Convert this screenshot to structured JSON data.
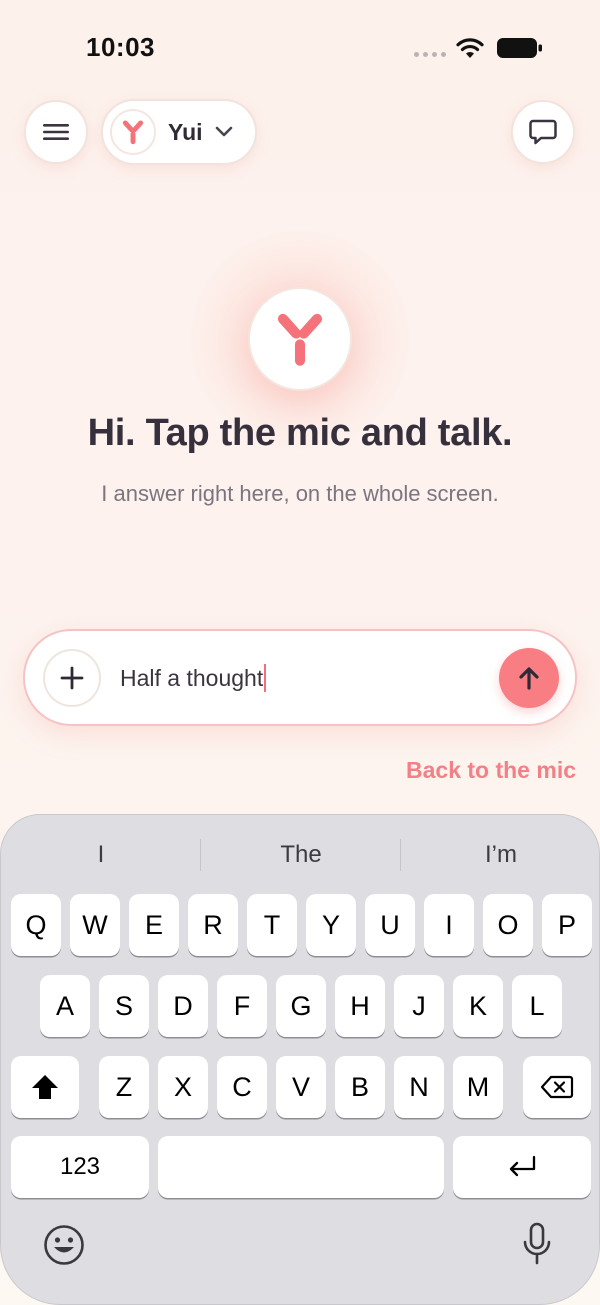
{
  "status_bar": {
    "time": "10:03"
  },
  "header": {
    "persona_name": "Yui"
  },
  "hero": {
    "title": "Hi. Tap the mic and talk.",
    "subtitle": "I answer right here, on the whole screen."
  },
  "composer": {
    "input_value": "Half a thought"
  },
  "back_link": "Back to the mic",
  "keyboard": {
    "suggestions": [
      "I",
      "The",
      "I’m"
    ],
    "row1": [
      "Q",
      "W",
      "E",
      "R",
      "T",
      "Y",
      "U",
      "I",
      "O",
      "P"
    ],
    "row2": [
      "A",
      "S",
      "D",
      "F",
      "G",
      "H",
      "J",
      "K",
      "L"
    ],
    "row3": [
      "Z",
      "X",
      "C",
      "V",
      "B",
      "N",
      "M"
    ],
    "numbers_label": "123"
  },
  "colors": {
    "accent": "#f87e83",
    "link": "#f37f87",
    "keyboard_bg": "#dedde2"
  },
  "icons": {
    "menu": "menu-icon",
    "chevron": "chevron-down-icon",
    "chat": "chat-bubble-icon",
    "plus": "plus-icon",
    "send": "arrow-up-icon",
    "shift": "shift-icon",
    "delete": "backspace-icon",
    "return": "return-icon",
    "emoji": "emoji-icon",
    "dictation": "microphone-icon"
  }
}
